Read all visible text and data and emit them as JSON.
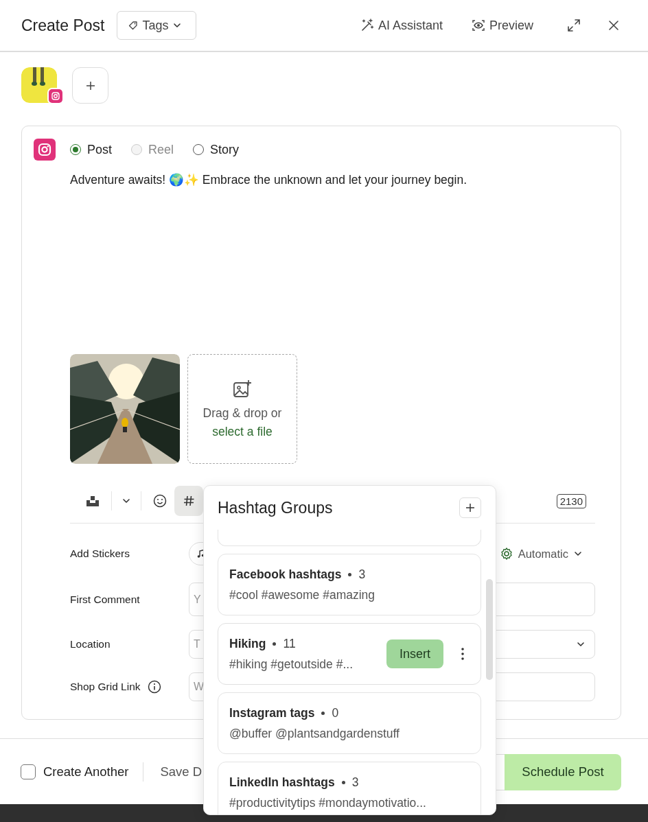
{
  "header": {
    "title": "Create Post",
    "tags_button": "Tags",
    "actions": [
      {
        "label": "AI Assistant"
      },
      {
        "label": "Preview"
      }
    ]
  },
  "composer": {
    "post_types": [
      {
        "label": "Post",
        "selected": true,
        "disabled": false
      },
      {
        "label": "Reel",
        "selected": false,
        "disabled": true
      },
      {
        "label": "Story",
        "selected": false,
        "disabled": false
      }
    ],
    "text": "Adventure awaits! 🌍✨ Embrace the unknown and let your journey begin.",
    "dropzone": {
      "text": "Drag & drop or",
      "link": "select a file"
    },
    "toolbar": {
      "hashtag_selected": true,
      "char_count": "2130"
    },
    "fields": [
      {
        "kind": "stickers",
        "label": "Add Stickers",
        "value": "Automatic",
        "info": false
      },
      {
        "kind": "text",
        "label": "First Comment",
        "placeholder": "Y",
        "info": false
      },
      {
        "kind": "select",
        "label": "Location",
        "placeholder": "T",
        "info": false
      },
      {
        "kind": "text",
        "label": "Shop Grid Link",
        "placeholder": "W",
        "info": true
      }
    ]
  },
  "hashtag_popover": {
    "title": "Hashtag Groups",
    "insert_label": "Insert",
    "groups": [
      {
        "name": "Facebook hashtags",
        "count": "3",
        "tags": "#cool #awesome #amazing",
        "selected": false
      },
      {
        "name": "Hiking",
        "count": "11",
        "tags": "#hiking #getoutside #...",
        "selected": true
      },
      {
        "name": "Instagram tags",
        "count": "0",
        "tags": "@buffer @plantsandgardenstuff",
        "selected": false
      },
      {
        "name": "LinkedIn hashtags",
        "count": "3",
        "tags": "#productivitytips #mondaymotivatio...",
        "selected": false
      }
    ]
  },
  "footer": {
    "create_another": {
      "label": "Create Another",
      "checked": false
    },
    "save_label": "Save D",
    "schedule_label": "Schedule Post"
  }
}
